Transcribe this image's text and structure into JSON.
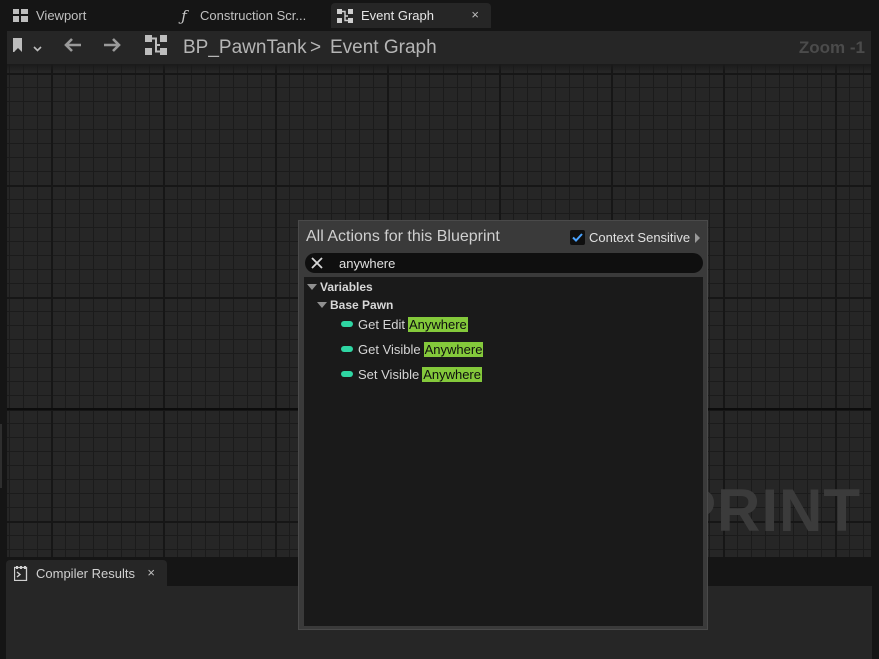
{
  "tabs": [
    {
      "label": "Viewport",
      "icon": "grid-icon"
    },
    {
      "label": "Construction Scr...",
      "icon": "function-icon"
    },
    {
      "label": "Event Graph",
      "icon": "graph-icon",
      "active": true
    }
  ],
  "close_glyph": "×",
  "toolbar": {
    "blueprint_name": "BP_PawnTank",
    "separator": ">",
    "graph_name": "Event Graph",
    "zoom": "Zoom -1"
  },
  "watermark": "PRINT",
  "popup": {
    "title": "All Actions for this Blueprint",
    "context_sensitive_label": "Context Sensitive",
    "context_sensitive_checked": true,
    "search_value": "anywhere",
    "categories": [
      {
        "label": "Variables"
      },
      {
        "label": "Base Pawn"
      }
    ],
    "items": [
      {
        "prefix": "Get Edit",
        "match": "Anywhere"
      },
      {
        "prefix": "Get Visible",
        "match": "Anywhere"
      },
      {
        "prefix": "Set Visible",
        "match": "Anywhere"
      }
    ],
    "variable_pin_color": "#2fd6a3",
    "highlight_color": "#84c93b"
  },
  "bottom_panel": {
    "tab_label": "Compiler Results"
  }
}
